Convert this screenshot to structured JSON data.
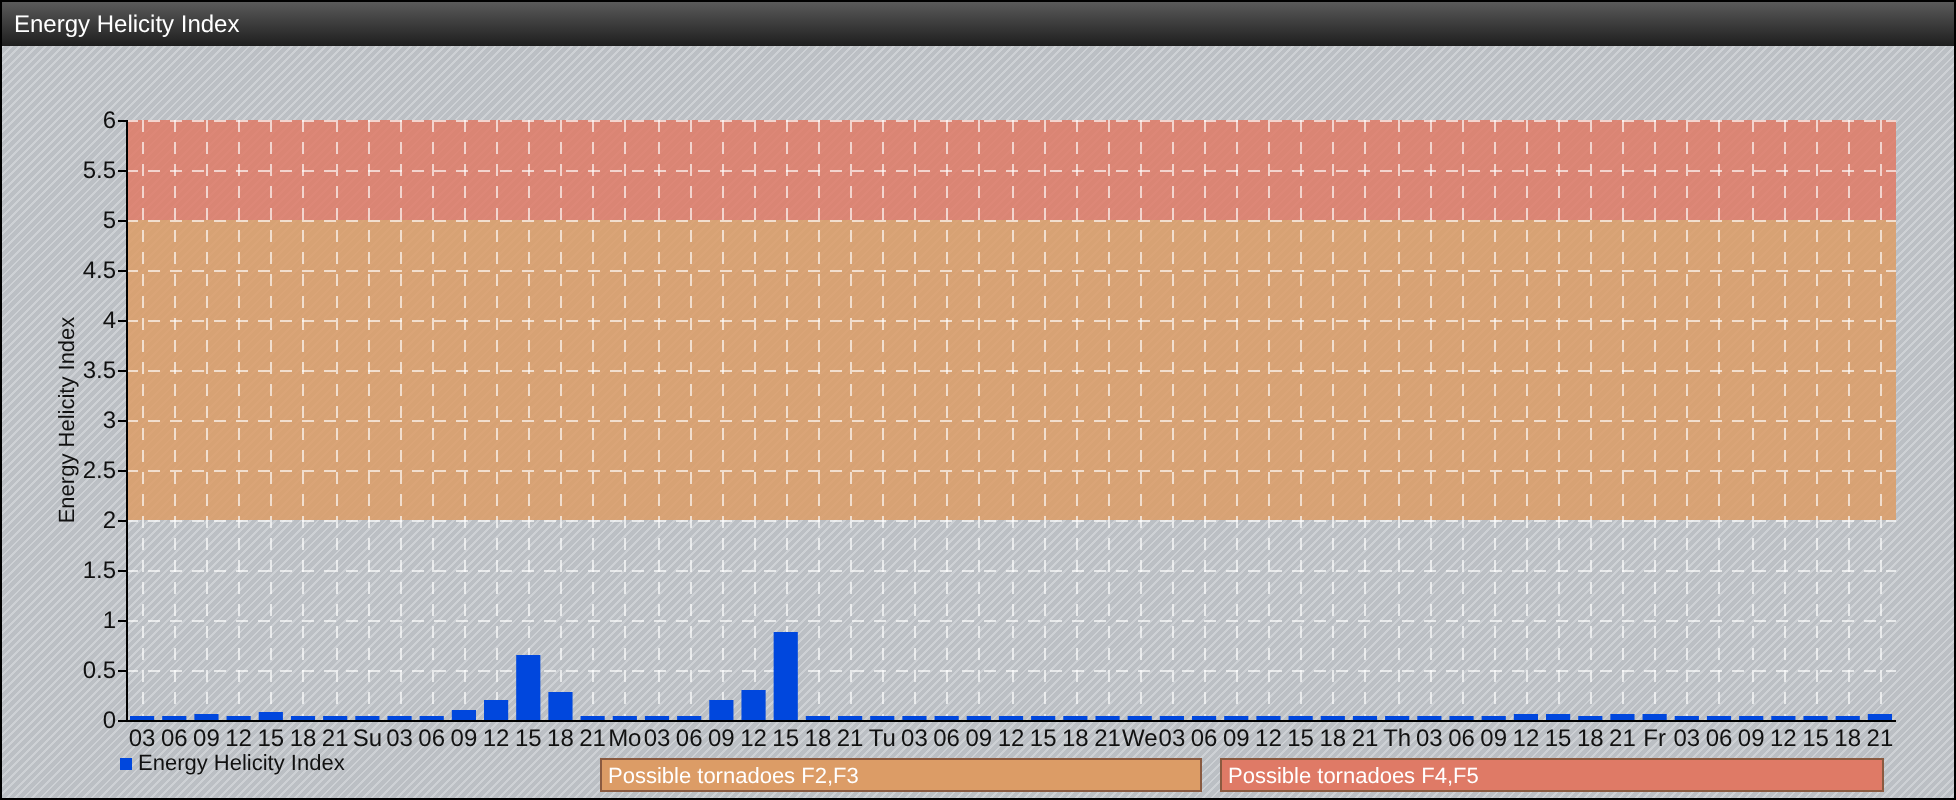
{
  "window": {
    "title": "Energy Helicity Index"
  },
  "chart_data": {
    "type": "bar",
    "ylabel": "Energy Helicity Index",
    "ylim": [
      0,
      6
    ],
    "yticks": [
      0,
      0.5,
      1,
      1.5,
      2,
      2.5,
      3,
      3.5,
      4,
      4.5,
      5,
      5.5,
      6
    ],
    "grid": true,
    "categories": [
      "03",
      "06",
      "09",
      "12",
      "15",
      "18",
      "21",
      "Su",
      "03",
      "06",
      "09",
      "12",
      "15",
      "18",
      "21",
      "Mo",
      "03",
      "06",
      "09",
      "12",
      "15",
      "18",
      "21",
      "Tu",
      "03",
      "06",
      "09",
      "12",
      "15",
      "18",
      "21",
      "We",
      "03",
      "06",
      "09",
      "12",
      "15",
      "18",
      "21",
      "Th",
      "03",
      "06",
      "09",
      "12",
      "15",
      "18",
      "21",
      "Fr",
      "03",
      "06",
      "09",
      "12",
      "15",
      "18",
      "21"
    ],
    "series": [
      {
        "name": "Energy Helicity Index",
        "color": "#0047dd",
        "values": [
          0.04,
          0.04,
          0.06,
          0.04,
          0.08,
          0.04,
          0.04,
          0.04,
          0.04,
          0.04,
          0.1,
          0.2,
          0.65,
          0.28,
          0.04,
          0.04,
          0.04,
          0.04,
          0.2,
          0.3,
          0.88,
          0.04,
          0.04,
          0.04,
          0.04,
          0.04,
          0.04,
          0.04,
          0.04,
          0.04,
          0.04,
          0.04,
          0.04,
          0.04,
          0.04,
          0.04,
          0.04,
          0.04,
          0.04,
          0.04,
          0.04,
          0.04,
          0.04,
          0.06,
          0.06,
          0.04,
          0.06,
          0.06,
          0.04,
          0.04,
          0.04,
          0.04,
          0.04,
          0.04,
          0.06
        ]
      }
    ],
    "bands": [
      {
        "axis": "y",
        "from": 2,
        "to": 5,
        "color": "#dc9c66"
      },
      {
        "axis": "y",
        "from": 5,
        "to": 6,
        "color": "#df7a66"
      }
    ]
  },
  "band_legend": [
    {
      "label": "Possible tornadoes F2,F3",
      "color": "#dc9c66"
    },
    {
      "label": "Possible tornadoes F4,F5",
      "color": "#df7a66"
    }
  ]
}
